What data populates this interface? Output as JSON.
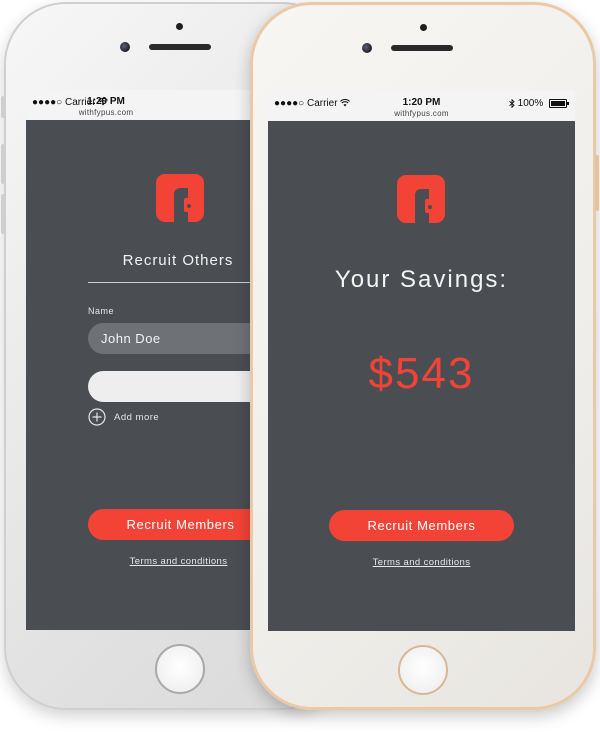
{
  "status_bar": {
    "carrier": "Carrier",
    "time": "1:20 PM",
    "url": "withfypus.com",
    "battery": "100%"
  },
  "left_screen": {
    "heading": "Recruit Others",
    "name_label": "Name",
    "name_value": "John Doe",
    "second_field_value": "",
    "add_more": "Add more",
    "button": "Recruit Members",
    "terms": "Terms and conditions"
  },
  "right_screen": {
    "title": "Your Savings:",
    "amount": "$543",
    "button": "Recruit Members",
    "terms": "Terms and conditions"
  },
  "icons": [
    "signal-dots-icon",
    "wifi-icon",
    "bluetooth-icon",
    "battery-icon",
    "app-logo-icon",
    "plus-circle-icon",
    "camera-icon",
    "home-button-icon"
  ],
  "colors": {
    "accent": "#f24336",
    "screen_bg": "#4a4d52",
    "field_filled": "#6e7175",
    "field_empty": "#eeeeee",
    "right_frame": "#e9c9a6"
  }
}
